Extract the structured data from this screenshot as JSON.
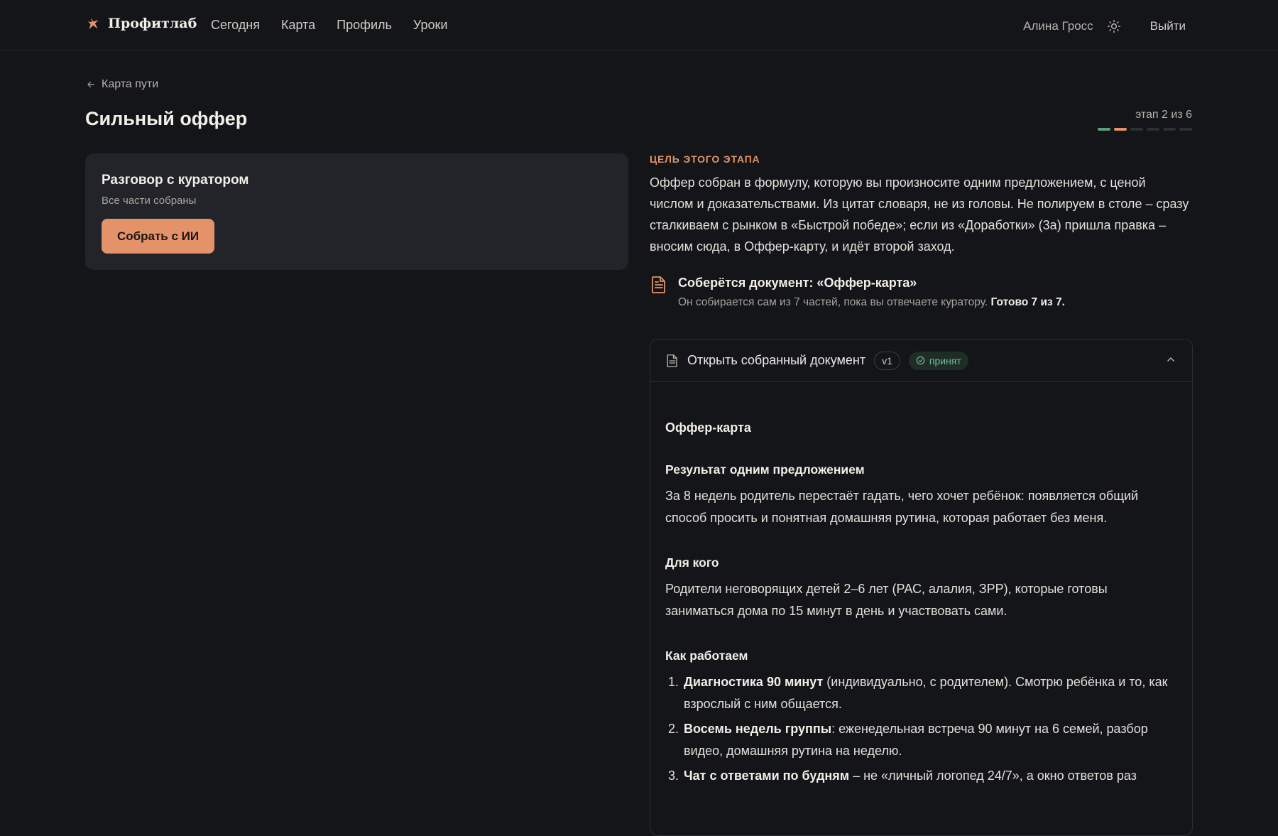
{
  "brand": {
    "name": "Профитлаб"
  },
  "nav": [
    {
      "label": "Сегодня"
    },
    {
      "label": "Карта"
    },
    {
      "label": "Профиль"
    },
    {
      "label": "Уроки"
    }
  ],
  "user": {
    "name": "Алина Гросс",
    "logout_label": "Выйти"
  },
  "back_link": {
    "label": "Карта пути"
  },
  "page": {
    "title": "Сильный оффер"
  },
  "stage": {
    "label": "этап 2 из 6",
    "current": 2,
    "total": 6,
    "colors": {
      "done": "#5E9E7C",
      "current": "#E39269",
      "pending": "#2C2F33"
    }
  },
  "curator_card": {
    "title": "Разговор с куратором",
    "subtitle": "Все части собраны",
    "button_label": "Собрать с ИИ"
  },
  "goal": {
    "label": "Цель этого этапа",
    "text": "Оффер собран в формулу, которую вы произносите одним предложением, с ценой числом и доказательствами. Из цитат словаря, не из головы. Не полируем в столе – сразу сталкиваем с рынком в «Быстрой победе»; если из «Доработки» (3а) пришла правка – вносим сюда, в Оффер-карту, и идёт второй заход."
  },
  "document_info": {
    "title": "Соберётся документ: «Оффер-карта»",
    "desc": "Он собирается сам из 7 частей, пока вы отвечаете куратору.",
    "ready": "Готово 7 из 7."
  },
  "doc_panel": {
    "title": "Открыть собранный документ",
    "version": "v1",
    "status": "принят",
    "content": {
      "title": "Оффер-карта",
      "sections": [
        {
          "heading": "Результат одним предложением",
          "text": "За 8 недель родитель перестаёт гадать, чего хочет ребёнок: появляется общий способ просить и понятная домашняя рутина, которая работает без меня."
        },
        {
          "heading": "Для кого",
          "text": "Родители неговорящих детей 2–6 лет (РАС, алалия, ЗРР), которые готовы заниматься дома по 15 минут в день и участвовать сами."
        }
      ],
      "how_heading": "Как работаем",
      "steps": [
        {
          "bold": "Диагностика 90 минут",
          "rest": " (индивидуально, с родителем). Смотрю ребёнка и то, как взрослый с ним общается."
        },
        {
          "bold": "Восемь недель группы",
          "rest": ": еженедельная встреча 90 минут на 6 семей, разбор видео, домашняя рутина на неделю."
        },
        {
          "bold": "Чат с ответами по будням",
          "rest": " – не «личный логопед 24/7», а окно ответов раз"
        }
      ]
    }
  },
  "icons": {
    "logo": "star-logo-icon",
    "theme": "sun-icon",
    "back": "arrow-left-icon",
    "document": "document-icon",
    "check": "check-circle-icon",
    "collapse": "chevron-up-icon"
  },
  "colors": {
    "accent": "#E39269",
    "success": "#6FBF93",
    "background": "#131518",
    "card": "#22242A"
  }
}
